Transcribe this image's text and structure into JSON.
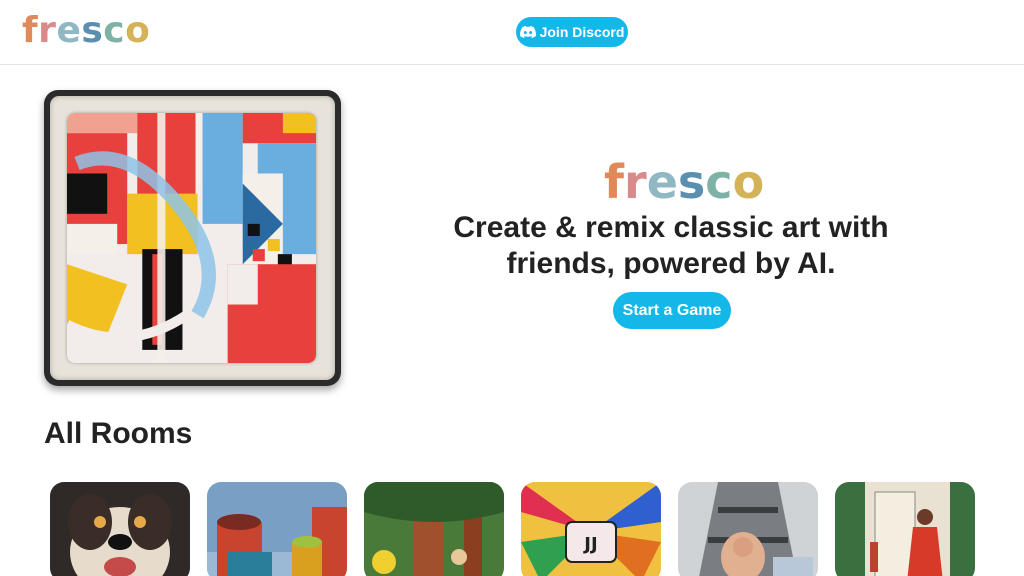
{
  "header": {
    "logo_letters": [
      "f",
      "r",
      "e",
      "s",
      "c",
      "o"
    ],
    "logo_colors": [
      "#e08a5a",
      "#d98a8a",
      "#8fb7c4",
      "#5b8fb0",
      "#7fb2a6",
      "#d4b257"
    ],
    "discord_label": "Join Discord",
    "discord_icon": "discord-icon"
  },
  "hero": {
    "logo_letters": [
      "f",
      "r",
      "e",
      "s",
      "c",
      "o"
    ],
    "title": "Create & remix classic art with friends, powered by AI.",
    "start_label": "Start a Game",
    "accent": "#14b8e8"
  },
  "rooms": {
    "heading": "All Rooms",
    "items": [
      {
        "subject": "dog-portrait"
      },
      {
        "subject": "cylinders"
      },
      {
        "subject": "forest-creatures"
      },
      {
        "subject": "psychedelic-jj"
      },
      {
        "subject": "eiffel-tower-wrestler"
      },
      {
        "subject": "garden-woman"
      }
    ]
  }
}
